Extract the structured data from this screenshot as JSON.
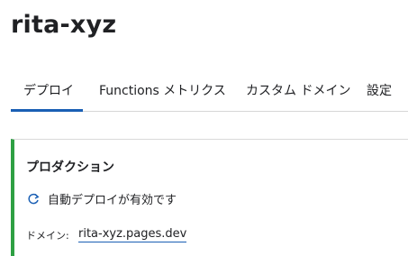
{
  "project": {
    "name": "rita-xyz"
  },
  "tabs": [
    {
      "label": "デプロイ"
    },
    {
      "label": "Functions メトリクス"
    },
    {
      "label": "カスタム ドメイン"
    },
    {
      "label": "設定"
    }
  ],
  "production": {
    "title": "プロダクション",
    "auto_deploy_icon": "refresh-icon",
    "auto_deploy_text": "自動デプロイが有効です",
    "domain_label": "ドメイン:",
    "domain_value": "rita-xyz.pages.dev",
    "status_color": "#2ea043"
  },
  "colors": {
    "accent": "#1a5fb4"
  }
}
